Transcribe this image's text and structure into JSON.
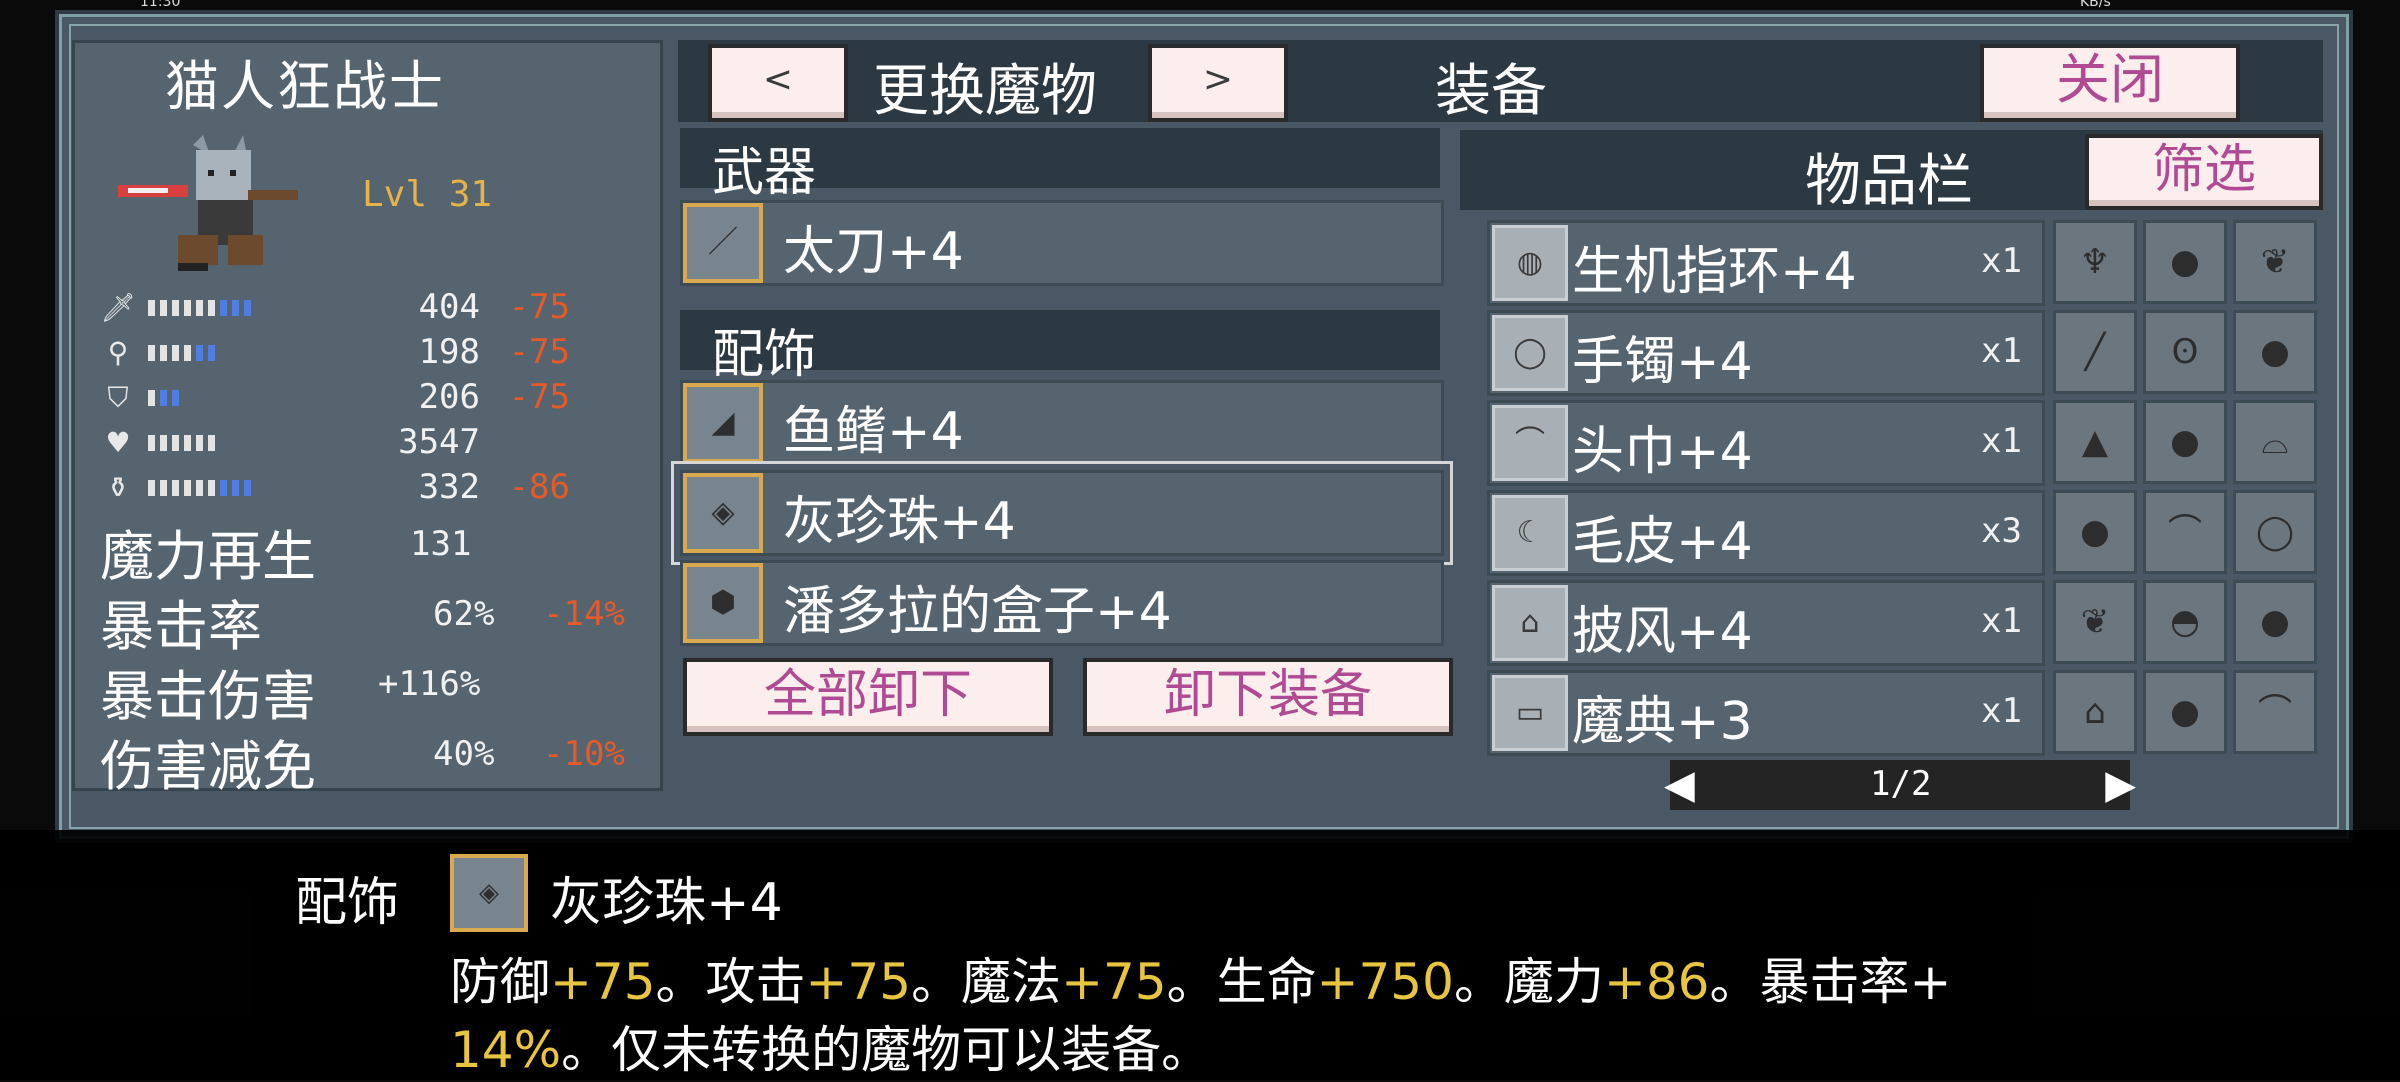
{
  "status": {
    "time": "11:30",
    "net": "KB/s"
  },
  "monster": {
    "name": "猫人狂战士",
    "level": "Lvl 31",
    "stats": [
      {
        "icon": "sword-icon",
        "value": "404",
        "mod": "-75",
        "white_bars": 6,
        "blue_bars": 3
      },
      {
        "icon": "wand-icon",
        "value": "198",
        "mod": "-75",
        "white_bars": 4,
        "blue_bars": 2
      },
      {
        "icon": "shield-icon",
        "value": "206",
        "mod": "-75",
        "white_bars": 1,
        "blue_bars": 2
      },
      {
        "icon": "heart-icon",
        "value": "3547",
        "mod": "",
        "white_bars": 6,
        "blue_bars": 0
      },
      {
        "icon": "mana-flask-icon",
        "value": "332",
        "mod": "-86",
        "white_bars": 6,
        "blue_bars": 3
      }
    ],
    "attrs": [
      {
        "name": "魔力再生",
        "value": "131",
        "mod": ""
      },
      {
        "name": "暴击率",
        "value": "62%",
        "mod": "-14%"
      },
      {
        "name": "暴击伤害",
        "value": "+116%",
        "mod": ""
      },
      {
        "name": "伤害减免",
        "value": "40%",
        "mod": "-10%"
      }
    ]
  },
  "topbar": {
    "prev": "<",
    "change_label": "更换魔物",
    "next": ">",
    "equip_label": "装备",
    "close": "关闭"
  },
  "equipment": {
    "weapon_header": "武器",
    "weapon": {
      "name": "太刀+4",
      "icon": "katana-icon"
    },
    "accessory_header": "配饰",
    "accessories": [
      {
        "name": "鱼鳍+4",
        "icon": "fin-icon"
      },
      {
        "name": "灰珍珠+4",
        "icon": "pearl-icon"
      },
      {
        "name": "潘多拉的盒子+4",
        "icon": "box-icon"
      }
    ],
    "unequip_all": "全部卸下",
    "unequip": "卸下装备"
  },
  "inventory": {
    "title": "物品栏",
    "filter": "筛选",
    "items": [
      {
        "name": "生机指环+4",
        "qty": "x1",
        "icon": "ring-icon",
        "slots": [
          "crab-icon",
          "pouch-icon",
          "feather-icon"
        ]
      },
      {
        "name": "手镯+4",
        "qty": "x1",
        "icon": "bracelet-icon",
        "slots": [
          "quill-icon",
          "amulet-icon",
          "pouch-icon"
        ]
      },
      {
        "name": "头巾+4",
        "qty": "x1",
        "icon": "headband-icon",
        "slots": [
          "hat-icon",
          "pouch-icon",
          "fin-icon"
        ]
      },
      {
        "name": "毛皮+4",
        "qty": "x3",
        "icon": "fur-icon",
        "slots": [
          "pouch-icon",
          "headband-icon",
          "bracelet-icon"
        ]
      },
      {
        "name": "披风+4",
        "qty": "x1",
        "icon": "cape-icon",
        "slots": [
          "feather-icon",
          "shell-icon",
          "pouch-icon"
        ]
      },
      {
        "name": "魔典+3",
        "qty": "x1",
        "icon": "tome-icon",
        "slots": [
          "cape-icon",
          "pouch-icon",
          "headband-icon"
        ]
      }
    ],
    "page": "1/2"
  },
  "description": {
    "category": "配饰",
    "item_name": "灰珍珠+4",
    "parts": [
      {
        "t": "防御",
        "c": "w"
      },
      {
        "t": "+75",
        "c": "y"
      },
      {
        "t": "。攻击",
        "c": "w"
      },
      {
        "t": "+75",
        "c": "y"
      },
      {
        "t": "。魔法",
        "c": "w"
      },
      {
        "t": "+75",
        "c": "y"
      },
      {
        "t": "。生命",
        "c": "w"
      },
      {
        "t": "+750",
        "c": "y"
      },
      {
        "t": "。魔力",
        "c": "w"
      },
      {
        "t": "+86",
        "c": "y"
      },
      {
        "t": "。暴击率+",
        "c": "w"
      }
    ],
    "line2_value": "14%",
    "line2_text": "。仅未转换的魔物可以装备。"
  },
  "colors": {
    "panel": "#56646f",
    "window": "#4a5866",
    "mod_red": "#e45a28",
    "level_gold": "#e6b34a",
    "button_pink": "#b04a92",
    "value_yellow": "#e8c53e"
  }
}
